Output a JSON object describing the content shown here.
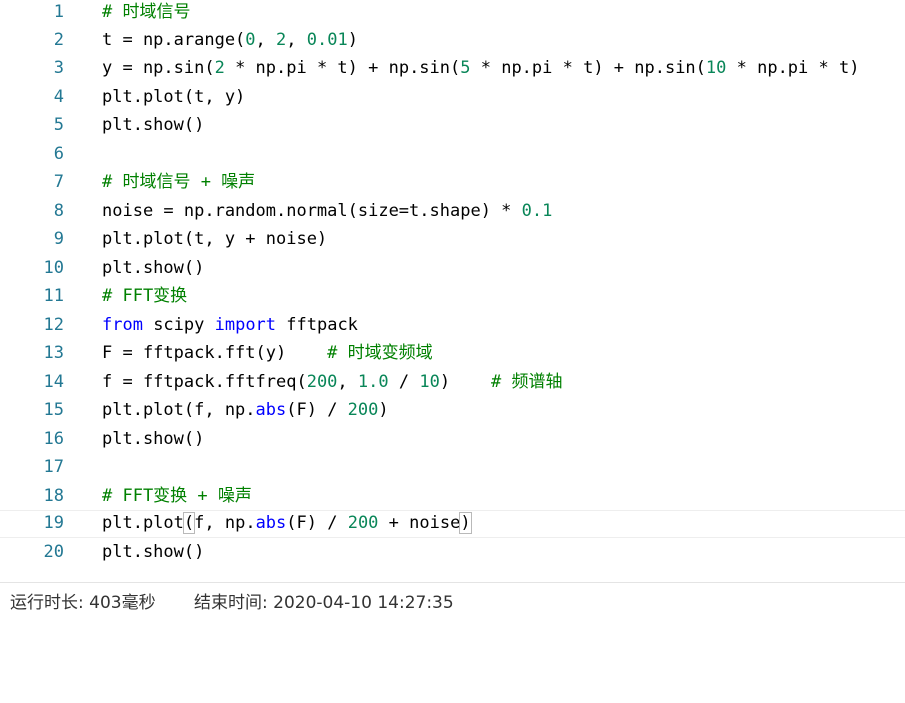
{
  "editor": {
    "lines": [
      {
        "num": "1"
      },
      {
        "num": "2"
      },
      {
        "num": "3"
      },
      {
        "num": "4"
      },
      {
        "num": "5"
      },
      {
        "num": "6"
      },
      {
        "num": "7"
      },
      {
        "num": "8"
      },
      {
        "num": "9"
      },
      {
        "num": "10"
      },
      {
        "num": "11"
      },
      {
        "num": "12"
      },
      {
        "num": "13"
      },
      {
        "num": "14"
      },
      {
        "num": "15"
      },
      {
        "num": "16"
      },
      {
        "num": "17"
      },
      {
        "num": "18"
      },
      {
        "num": "19"
      },
      {
        "num": "20"
      }
    ],
    "code": {
      "l1": "# 时域信号",
      "l2_a": "t = np.arange(",
      "l2_n1": "0",
      "l2_b": ", ",
      "l2_n2": "2",
      "l2_c": ", ",
      "l2_n3": "0.01",
      "l2_d": ")",
      "l3_a": "y = np.sin(",
      "l3_n1": "2",
      "l3_b": " * np.pi * t) + np.sin(",
      "l3_n2": "5",
      "l3_c": " * np.pi * t) + np.sin(",
      "l3_n3": "10",
      "l3_d": " * np.pi * t)",
      "l4": "plt.plot(t, y)",
      "l5": "plt.show()",
      "l6": "",
      "l7": "# 时域信号 + 噪声",
      "l8_a": "noise = np.random.normal(size=t.shape) * ",
      "l8_n1": "0.1",
      "l9": "plt.plot(t, y + noise)",
      "l10": "plt.show()",
      "l11": "# FFT变换",
      "l12_kw1": "from",
      "l12_a": " scipy ",
      "l12_kw2": "import",
      "l12_b": " fftpack",
      "l13_a": "F = fftpack.fft(y)    ",
      "l13_c": "# 时域变频域",
      "l14_a": "f = fftpack.fftfreq(",
      "l14_n1": "200",
      "l14_b": ", ",
      "l14_n2": "1.0",
      "l14_c": " / ",
      "l14_n3": "10",
      "l14_d": ")    ",
      "l14_cm": "# 频谱轴",
      "l15_a": "plt.plot(f, np.",
      "l15_kw": "abs",
      "l15_b": "(F) / ",
      "l15_n1": "200",
      "l15_c": ")",
      "l16": "plt.show()",
      "l17": "",
      "l18": "# FFT变换 + 噪声",
      "l19_a": "plt.plot",
      "l19_paren_open": "(",
      "l19_b": "f, np.",
      "l19_kw": "abs",
      "l19_c": "(F) / ",
      "l19_n1": "200",
      "l19_d": " + noise",
      "l19_paren_close": ")",
      "l20": "plt.show()"
    }
  },
  "status": {
    "runtime": "运行时长: 403毫秒",
    "end_time": "结束时间: 2020-04-10 14:27:35"
  },
  "colors": {
    "line_number": "#237893",
    "keyword": "#0000ff",
    "number": "#098658",
    "comment": "#008000"
  }
}
